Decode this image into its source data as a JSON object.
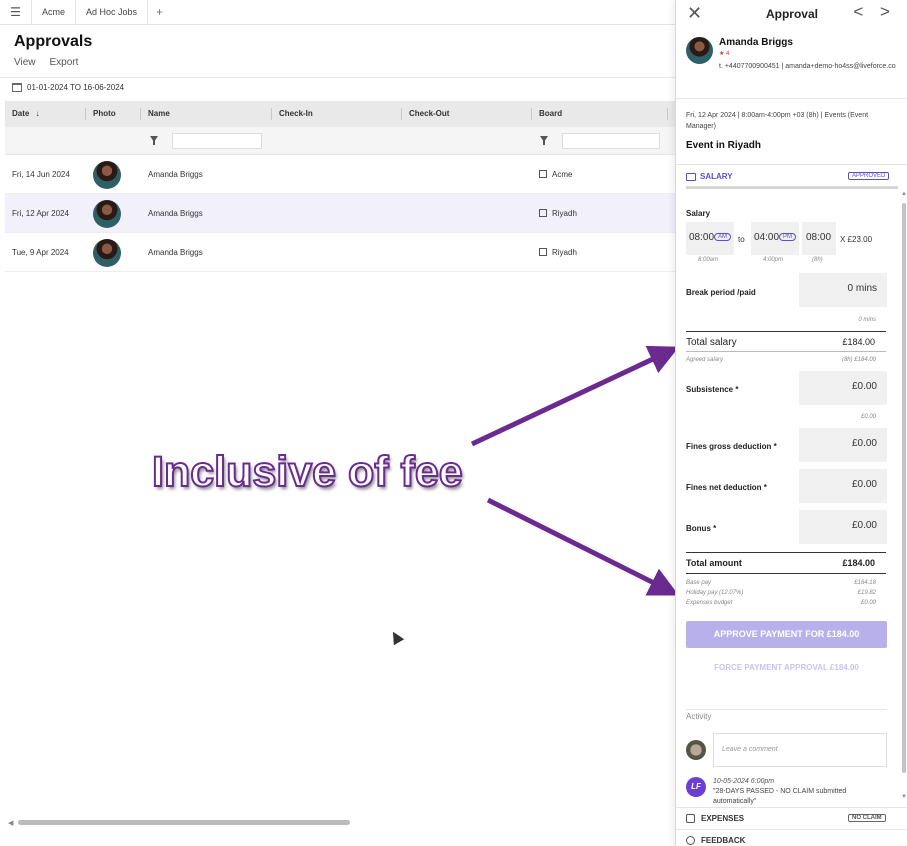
{
  "topbar": {
    "tabs": [
      "Acme",
      "Ad Hoc Jobs"
    ],
    "add": "+"
  },
  "page": {
    "title": "Approvals",
    "actions": [
      "View",
      "Export"
    ],
    "date_range": "01-01-2024 TO 16-06-2024"
  },
  "grid": {
    "columns": {
      "date": "Date",
      "sort_icon": "↓",
      "photo": "Photo",
      "name": "Name",
      "checkin": "Check-In",
      "checkout": "Check-Out",
      "board": "Board"
    },
    "rows": [
      {
        "date": "Fri, 14 Jun 2024",
        "name": "Amanda Briggs",
        "board": "Acme"
      },
      {
        "date": "Fri, 12 Apr 2024",
        "name": "Amanda Briggs",
        "board": "Riyadh"
      },
      {
        "date": "Tue, 9 Apr 2024",
        "name": "Amanda Briggs",
        "board": "Riyadh"
      }
    ]
  },
  "annotation": {
    "text": "Inclusive of fee"
  },
  "panel": {
    "title": "Approval",
    "nav": "< >",
    "close": "✕",
    "person": {
      "name": "Amanda Briggs",
      "rating": "★ 4",
      "contact": "t. +4407700900451 | amanda+demo-ho4ss@liveforce.co"
    },
    "meta": "Fri, 12 Apr 2024 | 8:00am-4:00pm +03 (8h) | Events (Event Manager)",
    "event": "Event in Riyadh",
    "salary_section": {
      "label": "SALARY",
      "status": "APPROVED"
    },
    "salary": {
      "label": "Salary",
      "start": "08:00",
      "start_ampm": "AM",
      "start_sub": "8:00am",
      "to": "to",
      "end": "04:00",
      "end_ampm": "PM",
      "end_sub": "4:00pm",
      "hours": "08:00",
      "hours_sub": "(8h)",
      "rate": "X  £23.00"
    },
    "break": {
      "label": "Break period /paid",
      "value": "0 mins",
      "sub": "0 mins"
    },
    "total_salary": {
      "label": "Total salary",
      "value": "£184.00",
      "sub_label": "Agreed salary",
      "sub_value": "(8h) £184.00"
    },
    "subsistence": {
      "label": "Subsistence *",
      "value": "£0.00",
      "sub": "£0.00"
    },
    "fines_gross": {
      "label": "Fines gross deduction *",
      "value": "£0.00"
    },
    "fines_net": {
      "label": "Fines net deduction *",
      "value": "£0.00"
    },
    "bonus": {
      "label": "Bonus *",
      "value": "£0.00"
    },
    "total_amount": {
      "label": "Total amount",
      "value": "£184.00"
    },
    "breakdown": [
      {
        "label": "Base pay",
        "value": "£164.18"
      },
      {
        "label": "Holiday pay (12.07%)",
        "value": "£19.82"
      },
      {
        "label": "Expenses budget",
        "value": "£0.00"
      }
    ],
    "approve_button": "APPROVE PAYMENT FOR £184.00",
    "force_button": "FORCE PAYMENT APPROVAL £184.00",
    "activity": {
      "label": "Activity",
      "comment_placeholder": "Leave a comment",
      "log_icon": "LF",
      "log_date": "10-05-2024 6:00pm",
      "log_text": "\"28-DAYS PASSED - NO CLAIM submitted automatically\""
    },
    "expenses": {
      "label": "EXPENSES",
      "status": "NO CLAIM"
    },
    "feedback": {
      "label": "FEEDBACK"
    }
  },
  "colors": {
    "accent": "#5b4fc8",
    "annotation": "#7b2fa5",
    "button": "#b7b0ea"
  }
}
